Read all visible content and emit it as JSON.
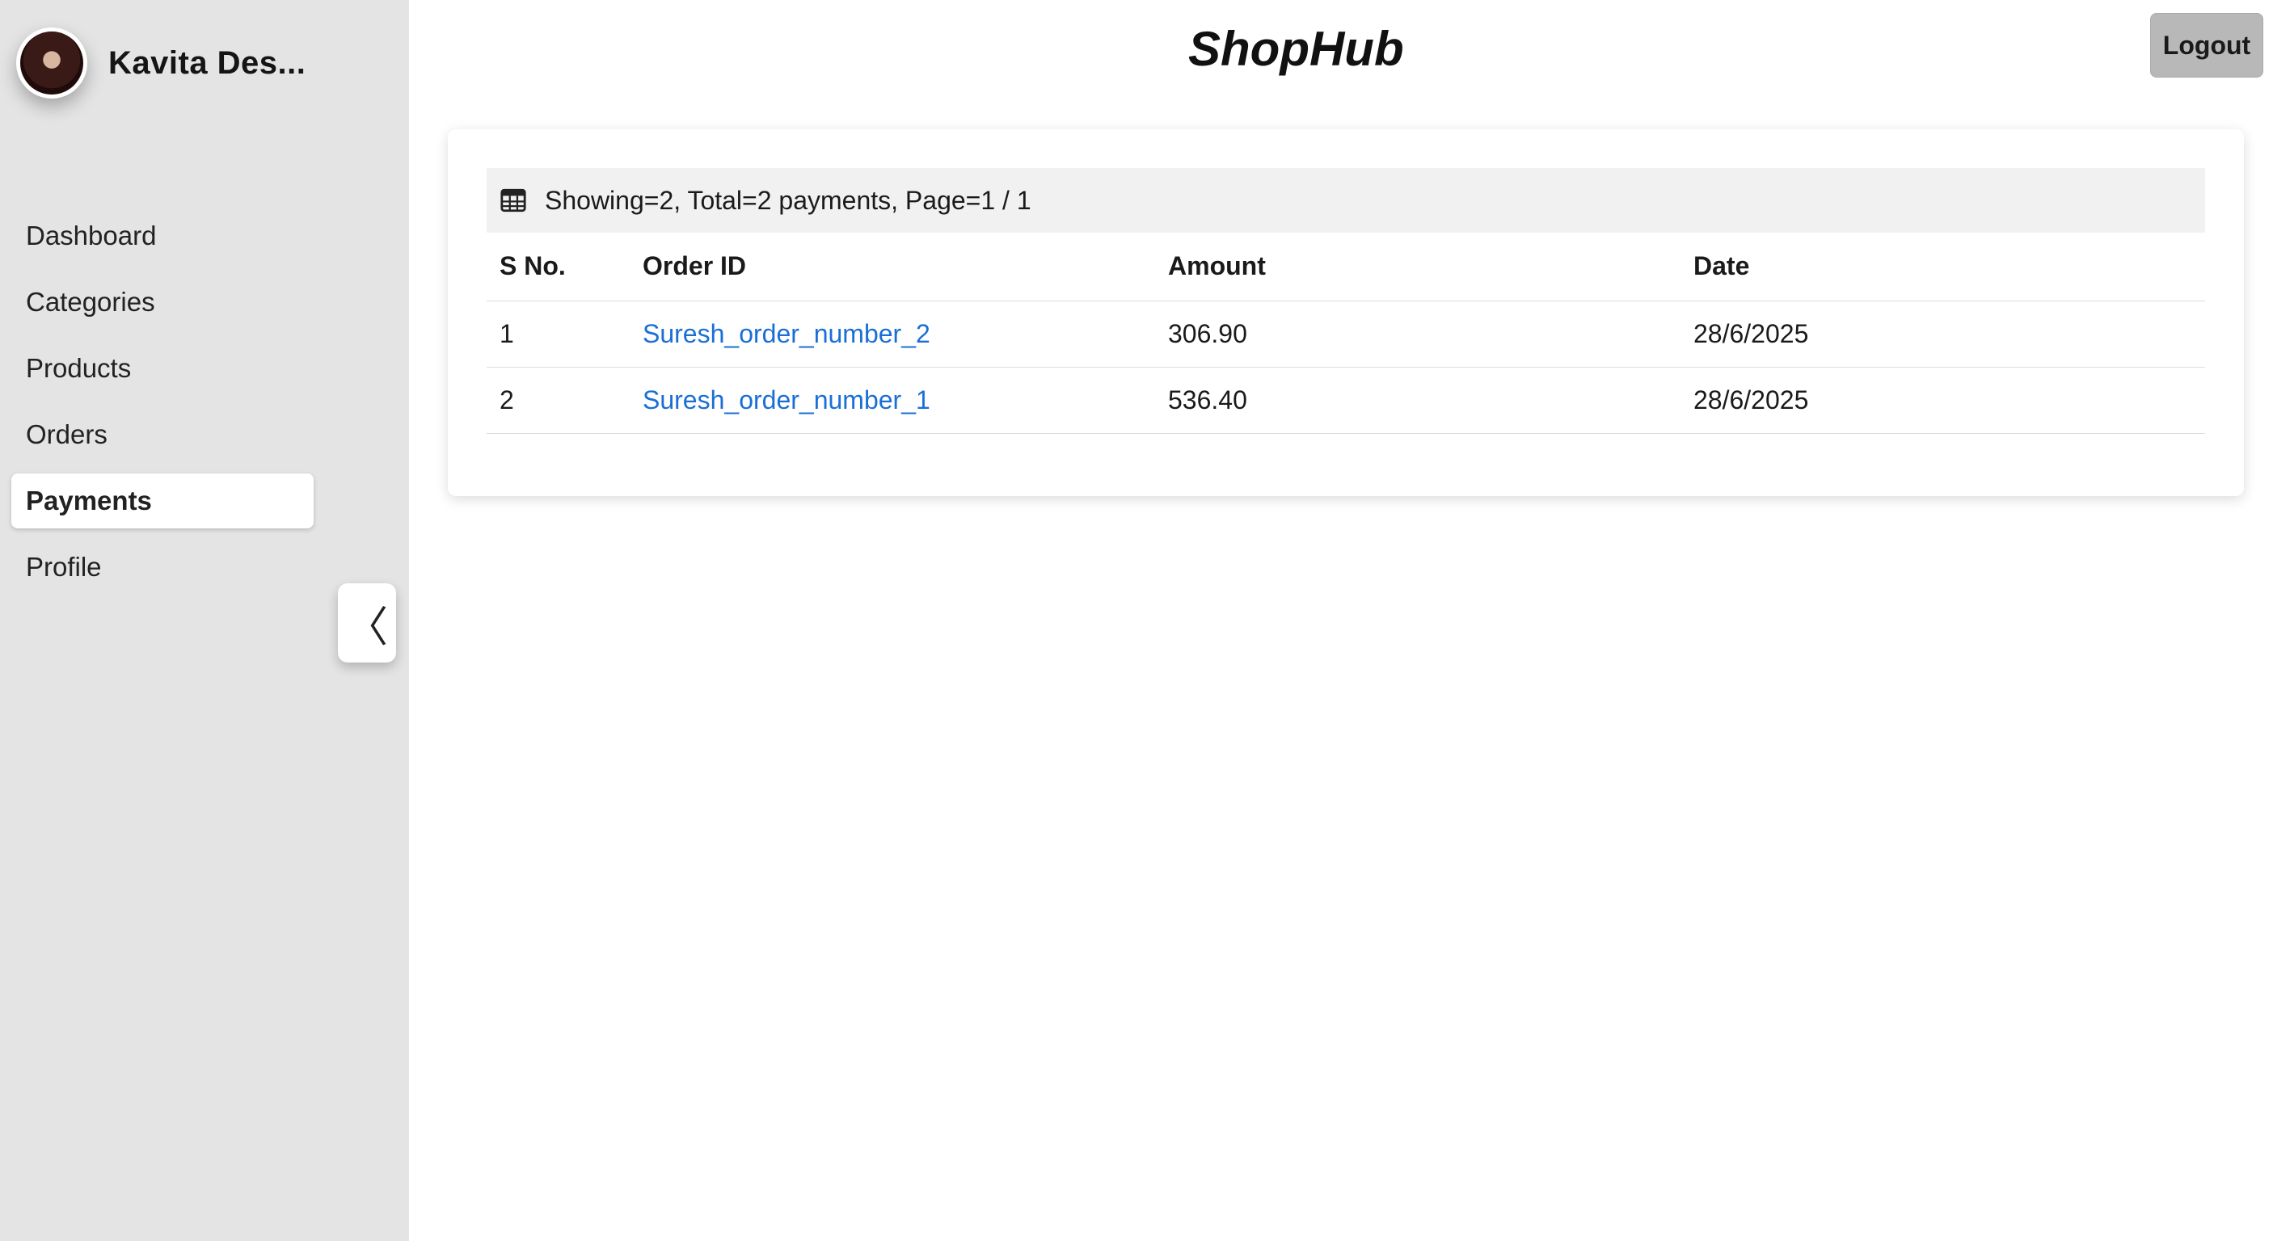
{
  "app": {
    "brand": "ShopHub"
  },
  "user": {
    "name": "Kavita Des..."
  },
  "header": {
    "logout_label": "Logout"
  },
  "sidebar": {
    "items": [
      {
        "label": "Dashboard",
        "active": false
      },
      {
        "label": "Categories",
        "active": false
      },
      {
        "label": "Products",
        "active": false
      },
      {
        "label": "Orders",
        "active": false
      },
      {
        "label": "Payments",
        "active": true
      },
      {
        "label": "Profile",
        "active": false
      }
    ],
    "collapse_glyph": "〈"
  },
  "payments": {
    "summary": "Showing=2, Total=2 payments, Page=1 / 1",
    "summary_icon": "table-icon",
    "columns": [
      "S No.",
      "Order ID",
      "Amount",
      "Date"
    ],
    "rows": [
      {
        "sno": "1",
        "order_id": "Suresh_order_number_2",
        "amount": "306.90",
        "date": "28/6/2025"
      },
      {
        "sno": "2",
        "order_id": "Suresh_order_number_1",
        "amount": "536.40",
        "date": "28/6/2025"
      }
    ]
  },
  "colors": {
    "link": "#1a6fd6",
    "sidebar_bg": "#e4e4e4",
    "logout_bg": "#b8b8b8"
  }
}
